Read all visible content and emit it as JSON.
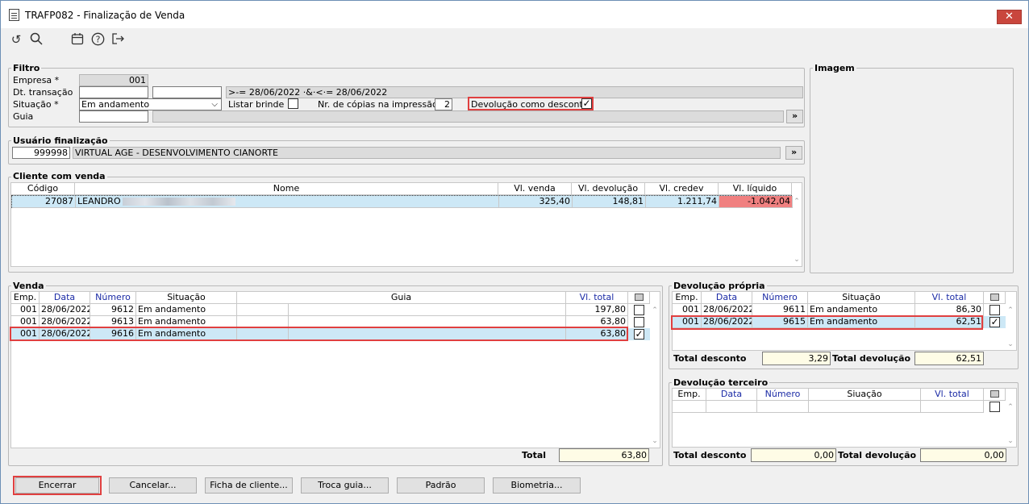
{
  "window": {
    "title": "TRAFP082 - Finalização de Venda",
    "close": "✕"
  },
  "toolbar": {
    "refresh": "↺",
    "search": "🔍",
    "calendar": "📅",
    "help": "?",
    "exit": "⇥"
  },
  "filtro": {
    "title": "Filtro",
    "empresa_label": "Empresa *",
    "empresa": "001",
    "dt_label": "Dt. transação",
    "dt_from": "",
    "dt_to": "",
    "dt_expr": ">-= 28/06/2022 ·&·<·= 28/06/2022",
    "situacao_label": "Situação *",
    "situacao": "Em andamento",
    "listar_brinde_label": "Listar brinde",
    "copias_label": "Nr. de cópias na impressão",
    "copias": "2",
    "devolucao_desconto_label": "Devolução como desconto",
    "guia_label": "Guia",
    "guia": "",
    "guia_btn": "»"
  },
  "usuario": {
    "title": "Usuário finalização",
    "codigo": "999998",
    "nome": "VIRTUAL AGE - DESENVOLVIMENTO CIANORTE",
    "btn": "»"
  },
  "imagem": {
    "title": "Imagem"
  },
  "cliente": {
    "title": "Cliente com venda",
    "headers": [
      "Código",
      "Nome",
      "Vl. venda",
      "Vl. devolução",
      "Vl. credev",
      "Vl. líquido"
    ],
    "row": {
      "codigo": "27087",
      "nome": "LEANDRO",
      "venda": "325,40",
      "devolucao": "148,81",
      "credev": "1.211,74",
      "liquido": "-1.042,04"
    }
  },
  "venda": {
    "title": "Venda",
    "headers": [
      "Emp.",
      "Data",
      "Número",
      "Situação",
      "Guia",
      "Vl. total"
    ],
    "rows": [
      {
        "emp": "001",
        "data": "28/06/2022",
        "numero": "9612",
        "situacao": "Em andamento",
        "guia": "",
        "total": "197,80",
        "checked": ""
      },
      {
        "emp": "001",
        "data": "28/06/2022",
        "numero": "9613",
        "situacao": "Em andamento",
        "guia": "",
        "total": "63,80",
        "checked": ""
      },
      {
        "emp": "001",
        "data": "28/06/2022",
        "numero": "9616",
        "situacao": "Em andamento",
        "guia": "",
        "total": "63,80",
        "checked": "✓"
      }
    ],
    "total_label": "Total",
    "total": "63,80"
  },
  "dev_propria": {
    "title": "Devolução própria",
    "headers": [
      "Emp.",
      "Data",
      "Número",
      "Situação",
      "Vl. total"
    ],
    "rows": [
      {
        "emp": "001",
        "data": "28/06/2022",
        "numero": "9611",
        "situacao": "Em andamento",
        "total": "86,30",
        "checked": ""
      },
      {
        "emp": "001",
        "data": "28/06/2022",
        "numero": "9615",
        "situacao": "Em andamento",
        "total": "62,51",
        "checked": "✓"
      }
    ],
    "total_desconto_label": "Total desconto",
    "total_desconto": "3,29",
    "total_devolucao_label": "Total devolução",
    "total_devolucao": "62,51"
  },
  "dev_terceiro": {
    "title": "Devolução terceiro",
    "headers": [
      "Emp.",
      "Data",
      "Número",
      "Siuação",
      "Vl. total"
    ],
    "total_desconto_label": "Total desconto",
    "total_desconto": "0,00",
    "total_devolucao_label": "Total devolução",
    "total_devolucao": "0,00"
  },
  "buttons": {
    "encerrar": "Encerrar",
    "cancelar": "Cancelar...",
    "ficha": "Ficha de cliente...",
    "troca": "Troca guia...",
    "padrao": "Padrão",
    "biometria": "Biometria..."
  },
  "colors": {
    "accent_red": "#e04040",
    "selected_row": "#cde8f6",
    "negative_cell": "#f08080"
  }
}
